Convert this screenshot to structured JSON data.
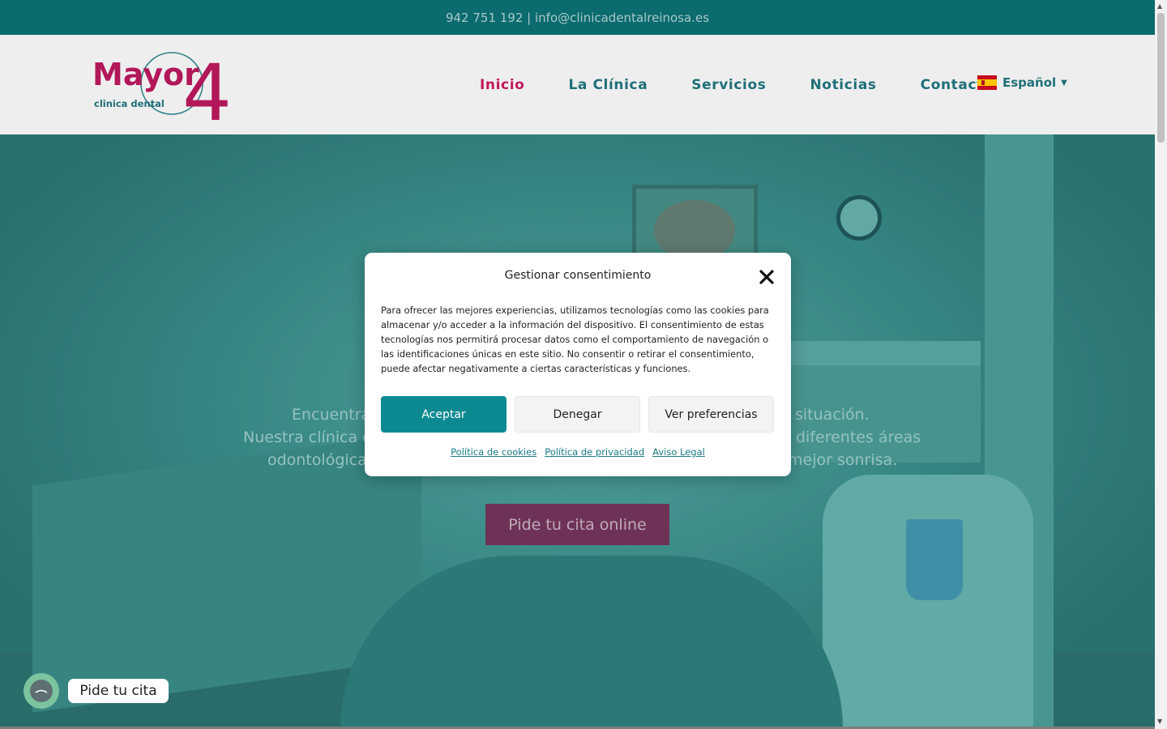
{
  "topbar": {
    "phone": "942 751 192",
    "separator": " | ",
    "email": "info@clinicadentalreinosa.es"
  },
  "header": {
    "logo_name": "Mayor 4",
    "logo_text_main": "Mayor",
    "logo_text_sub": "clinica dental",
    "logo_digit": "4",
    "nav": [
      {
        "label": "Inicio",
        "active": true
      },
      {
        "label": "La Clínica",
        "active": false
      },
      {
        "label": "Servicios",
        "active": false
      },
      {
        "label": "Noticias",
        "active": false
      },
      {
        "label": "Contacto",
        "active": false
      }
    ],
    "language": "Español"
  },
  "hero": {
    "line1_left": "Encuentra",
    "line1_right": "situación.",
    "line2_left": "Nuestra clínica d",
    "line2_right": "diferentes áreas",
    "line3_left": "odontológicas",
    "line3_right": "mejor sonrisa.",
    "cta_label": "Pide tu cita online"
  },
  "consent": {
    "title": "Gestionar consentimiento",
    "body": "Para ofrecer las mejores experiencias, utilizamos tecnologías como las cookies para almacenar y/o acceder a la información del dispositivo. El consentimiento de estas tecnologías nos permitirá procesar datos como el comportamiento de navegación o las identificaciones únicas en este sitio. No consentir o retirar el consentimiento, puede afectar negativamente a ciertas características y funciones.",
    "accept_label": "Aceptar",
    "deny_label": "Denegar",
    "prefs_label": "Ver preferencias",
    "links": [
      "Política de cookies",
      "Política de privacidad",
      "Aviso Legal"
    ]
  },
  "chat": {
    "label": "Pide tu cita"
  },
  "colors": {
    "topbar": "#0b6b6e",
    "accent_teal": "#0d8a91",
    "accent_magenta": "#c2185b",
    "nav_text": "#1f6f78"
  }
}
